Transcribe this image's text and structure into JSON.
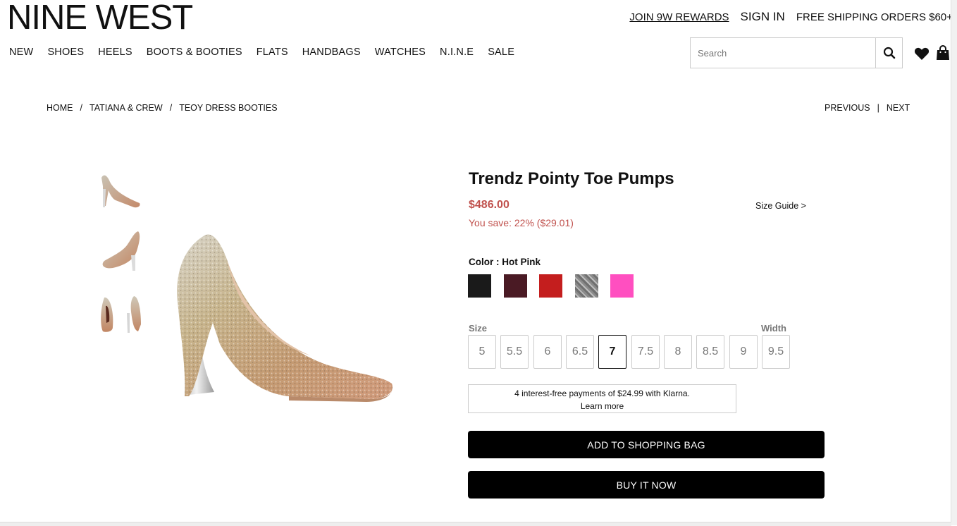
{
  "header": {
    "logo": "NINE WEST",
    "rewards_link": "JOIN 9W REWARDS",
    "signin_link": "SIGN IN",
    "shipping_text": "FREE SHIPPING ORDERS $60+",
    "search_placeholder": "Search"
  },
  "nav": {
    "items": [
      "NEW",
      "SHOES",
      "HEELS",
      "BOOTS & BOOTIES",
      "FLATS",
      "HANDBAGS",
      "WATCHES",
      "N.I.N.E",
      "SALE"
    ]
  },
  "breadcrumb": {
    "items": [
      "HOME",
      "TATIANA & CREW",
      "TEOY DRESS BOOTIES"
    ],
    "separator": "/",
    "previous": "PREVIOUS",
    "pipe": "|",
    "next": "NEXT"
  },
  "product": {
    "title": "Trendz Pointy Toe Pumps",
    "price": "$486.00",
    "savings": "You save: 22% ($29.01)",
    "size_guide": "Size Guide >",
    "color_label": "Color : ",
    "color_value": "Hot Pink",
    "swatches": [
      {
        "name": "black",
        "color": "#1a1a1a"
      },
      {
        "name": "burgundy",
        "color": "#4a1a24"
      },
      {
        "name": "red",
        "color": "#c41e1e"
      },
      {
        "name": "glitter-silver",
        "color": "#8a8a8a"
      },
      {
        "name": "hot-pink",
        "color": "#ff4fc0"
      }
    ],
    "size_label": "Size",
    "width_label": "Width",
    "sizes": [
      "5",
      "5.5",
      "6",
      "6.5",
      "7",
      "7.5",
      "8",
      "8.5",
      "9",
      "9.5"
    ],
    "selected_size": "7",
    "klarna_line1": "4 interest-free payments of $24.99 with Klarna.",
    "klarna_line2": "Learn more",
    "add_to_bag": "ADD TO SHOPPING BAG",
    "buy_now": "BUY IT NOW"
  },
  "colors": {
    "price": "#c0514d",
    "button": "#000000"
  }
}
